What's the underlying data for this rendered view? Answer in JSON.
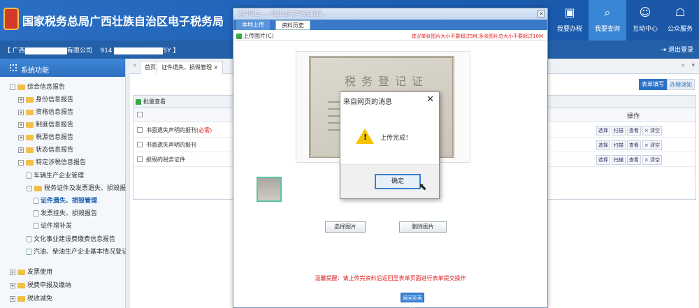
{
  "header": {
    "site_title": "国家税务总局广西壮族自治区电子税务局",
    "nav": [
      {
        "label": "我要办税",
        "icon": "tax-screen-icon"
      },
      {
        "label": "我要查询",
        "icon": "query-icon"
      },
      {
        "label": "互动中心",
        "icon": "chat-icon"
      },
      {
        "label": "公众服务",
        "icon": "service-icon"
      }
    ],
    "colors": {
      "primary": "#1b5fb5",
      "active_nav": "#3a86d6"
    }
  },
  "userbar": {
    "company_prefix": "【 广西",
    "company_suffix": "有限公司",
    "taxid_prefix": "914",
    "taxid_suffix": "5Y 】",
    "logout": "退出登录"
  },
  "sidebar": {
    "title": "系统功能",
    "items": [
      {
        "label": "综合信息报告"
      },
      {
        "label": "身份信息报告"
      },
      {
        "label": "资格信息报告"
      },
      {
        "label": "制度信息报告"
      },
      {
        "label": "税源信息报告"
      },
      {
        "label": "状态信息报告"
      },
      {
        "label": "特定涉税信息报告"
      },
      {
        "label": "车辆生产企业管理"
      },
      {
        "label": "税务证件及发票遗失、损毁报告"
      },
      {
        "label": "证件遗失、损毁管理"
      },
      {
        "label": "发票挂失、损毁报告"
      },
      {
        "label": "证件增补发"
      },
      {
        "label": "文化事业建设费缴费信息报告"
      },
      {
        "label": "汽油、柴油生产企业基本情况登记"
      },
      {
        "label": "发票使用"
      },
      {
        "label": "税费申报及缴纳"
      },
      {
        "label": "税收减免"
      }
    ]
  },
  "main": {
    "tabs": [
      {
        "label": "首页"
      },
      {
        "label": "证件遗失、损毁管理"
      }
    ],
    "btn_form_fill": "表单填写",
    "btn_guide": "办理须知",
    "panel_title": "批量查看",
    "ops_header": "操作",
    "rows": [
      {
        "name": "书面遗失声明的报刊",
        "req": "(必需)"
      },
      {
        "name": "书面遗失声明的报刊",
        "req": ""
      },
      {
        "name": "损毁的税务证件",
        "req": ""
      }
    ],
    "ops": [
      "选择",
      "扫描",
      "查看",
      "× 清空"
    ]
  },
  "dialog": {
    "title": "资料历史——刊登遗失声明的报刊...",
    "close": "×",
    "tab_local": "本地上传",
    "tab_history": "资料历史",
    "upload_label": "上传图片(C)",
    "upload_hint": "建议单张图片大小不要超过5M,多张图片总大小不要超过10M",
    "cert_title": "税务登记证",
    "btn_choose": "选择图片",
    "btn_delete": "删除图片",
    "reminder": "温馨提醒：请上传完资料后返回至表单页面进行表单提交操作",
    "btn_return": "返回至表单"
  },
  "msgbox": {
    "title": "来自网页的消息",
    "close": "✕",
    "text": "上传完成！",
    "ok": "确定"
  }
}
